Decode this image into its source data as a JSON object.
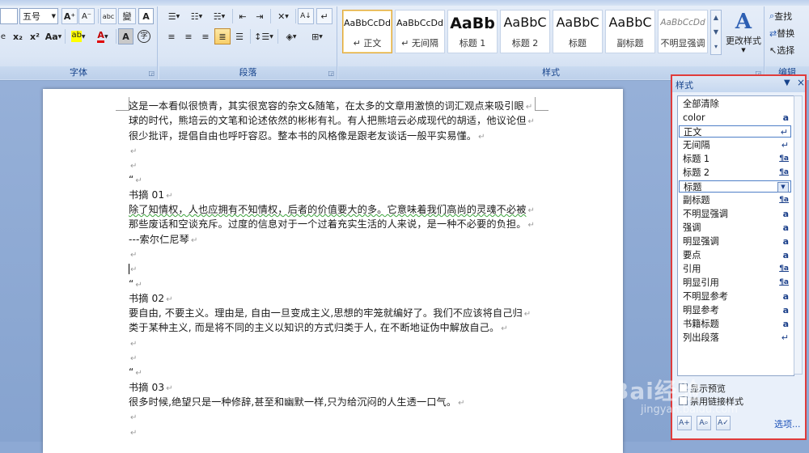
{
  "ribbon": {
    "font_group": {
      "label": "字体",
      "font_size": "五号",
      "grow_icon": "A⁺",
      "shrink_icon": "A⁻",
      "phonetic_icon": "abc",
      "phonetic_label": "變",
      "border_char": "A",
      "sub_icon": "x₂",
      "sup_icon": "x²",
      "case_label": "Aa",
      "highlight_label": "ab",
      "color_label": "A",
      "shade_label": "A",
      "circle_label": "字"
    },
    "para_group": {
      "label": "段落",
      "sort_label": "A↓",
      "mark_label": "↵"
    },
    "styles_group": {
      "label": "样式",
      "tiles": [
        {
          "sample": "AaBbCcDd",
          "name": "↵ 正文",
          "selected": true
        },
        {
          "sample": "AaBbCcDd",
          "name": "↵ 无间隔",
          "selected": false
        },
        {
          "sample": "AaBb",
          "name": "标题 1",
          "selected": false
        },
        {
          "sample": "AaBbC",
          "name": "标题 2",
          "selected": false
        },
        {
          "sample": "AaBbC",
          "name": "标题",
          "selected": false
        },
        {
          "sample": "AaBbC",
          "name": "副标题",
          "selected": false
        },
        {
          "sample": "AaBbCcDd",
          "name": "不明显强调",
          "selected": false
        }
      ],
      "change_styles": "更改样式"
    },
    "edit_group": {
      "label": "编辑",
      "find": "查找",
      "replace": "替换",
      "select": "选择"
    }
  },
  "document": {
    "lines": [
      "这是一本看似很愤青，其实很宽容的杂文&随笔，在太多的文章用激愤的词汇观点来吸引眼",
      "球的时代，熊培云的文笔和论述依然的彬彬有礼。有人把熊培云必成现代的胡适，他议论但",
      "很少批评，提倡自由也呼吁容忍。整本书的风格像是跟老友谈话一般平实易懂。",
      "",
      "",
      "“",
      "书摘 01",
      "除了知情权，人也应拥有不知情权，后者的价值要大的多。它意味着我们高尚的灵魂不必被",
      "那些废话和空谈充斥。过度的信息对于一个过着充实生活的人来说，是一种不必要的负担。",
      "---索尔仁尼琴",
      "",
      "",
      "“",
      "书摘 02",
      "要自由, 不要主义。理由是, 自由一旦变成主义,思想的牢笼就编好了。我们不应该将自己归",
      "类于某种主义, 而是将不同的主义以知识的方式归类于人, 在不断地证伪中解放自己。",
      "",
      "",
      "“",
      "书摘 03",
      "很多时候,绝望只是一种修辞,甚至和幽默一样,只为给沉闷的人生透一口气。",
      "",
      ""
    ]
  },
  "styles_pane": {
    "title": "样式",
    "items": [
      {
        "name": "全部清除",
        "mark": "",
        "selected": false
      },
      {
        "name": "color",
        "mark": "a",
        "selected": false
      },
      {
        "name": "正文",
        "mark": "↵",
        "selected": true
      },
      {
        "name": "无间隔",
        "mark": "↵",
        "selected": false
      },
      {
        "name": "标题 1",
        "mark": "¶a",
        "selected": false
      },
      {
        "name": "标题 2",
        "mark": "¶a",
        "selected": false
      },
      {
        "name": "标题",
        "mark": "▼",
        "selected": true
      },
      {
        "name": "副标题",
        "mark": "¶a",
        "selected": false
      },
      {
        "name": "不明显强调",
        "mark": "a",
        "selected": false
      },
      {
        "name": "强调",
        "mark": "a",
        "selected": false
      },
      {
        "name": "明显强调",
        "mark": "a",
        "selected": false
      },
      {
        "name": "要点",
        "mark": "a",
        "selected": false
      },
      {
        "name": "引用",
        "mark": "¶a",
        "selected": false
      },
      {
        "name": "明显引用",
        "mark": "¶a",
        "selected": false
      },
      {
        "name": "不明显参考",
        "mark": "a",
        "selected": false
      },
      {
        "name": "明显参考",
        "mark": "a",
        "selected": false
      },
      {
        "name": "书籍标题",
        "mark": "a",
        "selected": false
      },
      {
        "name": "列出段落",
        "mark": "↵",
        "selected": false
      }
    ],
    "show_preview": "显示预览",
    "disable_linked": "禁用链接样式",
    "options_link": "选项..."
  },
  "watermark": {
    "brand": "Bai经验",
    "url": "jingyan.baidu.com"
  }
}
